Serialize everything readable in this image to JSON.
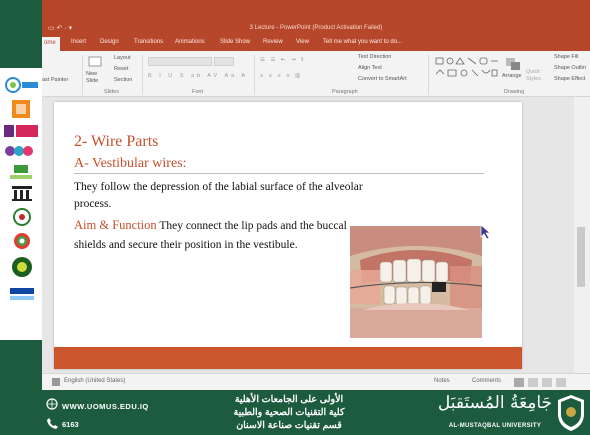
{
  "window": {
    "title": "3 Lecture - PowerPoint (Product Activation Failed)"
  },
  "ribbon_tabs": [
    "ome",
    "Insert",
    "Design",
    "Transitions",
    "Animations",
    "Slide Show",
    "Review",
    "View",
    "Tell me what you want to do..."
  ],
  "ribbon": {
    "clipboard": {
      "paste_label": "ast Painter",
      "group": ""
    },
    "slides": {
      "new_slide": "New Slide",
      "layout": "Layout",
      "reset": "Reset",
      "section": "Section",
      "group": "Slides"
    },
    "font": {
      "group": "Font"
    },
    "paragraph": {
      "text_direction": "Text Direction",
      "align_text": "Align Text",
      "convert": "Convert to SmartArt",
      "group": "Paragraph"
    },
    "drawing": {
      "arrange": "Arrange",
      "quick_styles": "Quick Styles",
      "shape_fill": "Shape Fill",
      "shape_outline": "Shape Outlin",
      "shape_effects": "Shape Effect",
      "group": "Drawing"
    }
  },
  "slide": {
    "title": "2- Wire Parts",
    "subtitle": "A- Vestibular wires:",
    "body": "They follow the depression of the labial surface of the alveolar process.",
    "aim_label": "Aim & Function",
    "aim_text": " They connect the lip pads and the buccal shields and secure their position in the vestibule."
  },
  "status": {
    "language": "English (United States)",
    "notes": "Notes",
    "comments": "Comments"
  },
  "banner": {
    "website": "WWW.UOMUS.EDU.IQ",
    "phone": "6163",
    "line1": "الأولى على الجامعات الأهلية",
    "line2": "كلية التقنيات الصحية والطبية",
    "line3": "قسم تقنيات صناعة الاسنان",
    "university_ar": "جَامِعَةُ المُستَقبَل",
    "university_en": "AL-MUSTAQBAL UNIVERSITY"
  },
  "logos": [
    "rur-logo",
    "the-logo",
    "the-impact-logo",
    "greenmetric-logo",
    "ui-green-logo",
    "institution-logo",
    "qs-logo",
    "sdg-logo",
    "gis-logo",
    "unirank-logo"
  ],
  "colors": {
    "powerpoint_red": "#b7472a",
    "slide_accent": "#c5502c",
    "banner_green": "#1d5b3f"
  }
}
